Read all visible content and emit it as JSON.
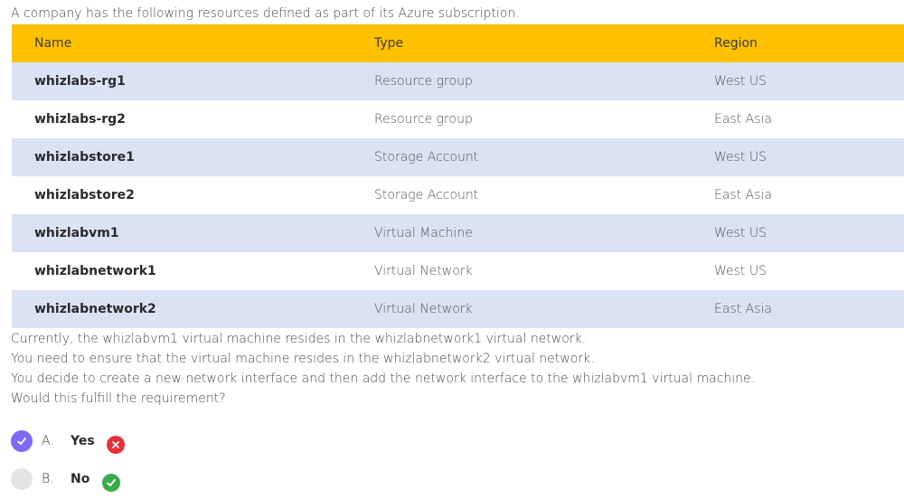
{
  "intro": "A company has the following resources defined as part of its Azure subscription.",
  "table": {
    "headers": [
      "Name",
      "Type",
      "Region"
    ],
    "rows": [
      {
        "name": "whizlabs-rg1",
        "type": "Resource group",
        "region": "West US"
      },
      {
        "name": "whizlabs-rg2",
        "type": "Resource group",
        "region": "East Asia"
      },
      {
        "name": "whizlabstore1",
        "type": "Storage Account",
        "region": "West US"
      },
      {
        "name": "whizlabstore2",
        "type": "Storage Account",
        "region": "East Asia"
      },
      {
        "name": "whizlabvm1",
        "type": "Virtual Machine",
        "region": "West US"
      },
      {
        "name": "whizlabnetwork1",
        "type": "Virtual Network",
        "region": "West US"
      },
      {
        "name": "whizlabnetwork2",
        "type": "Virtual Network",
        "region": "East Asia"
      }
    ]
  },
  "question": {
    "lines": [
      "Currently, the whizlabvm1 virtual machine resides in the whizlabnetwork1 virtual network.",
      "You need to ensure that the virtual machine resides in the whizlabnetwork2 virtual network.",
      "You decide to create a new network interface and then add the network interface to the whizlabvm1 virtual machine.",
      "Would this fulfill the requirement?"
    ]
  },
  "options": [
    {
      "letter": "A.",
      "text": "Yes",
      "selected": true,
      "result": "incorrect"
    },
    {
      "letter": "B.",
      "text": "No",
      "selected": false,
      "result": "correct"
    }
  ],
  "colors": {
    "header_bg": "#ffc000",
    "row_shade": "#dae3f3",
    "selected_radio": "#7b6cf6",
    "incorrect": "#e5303b",
    "correct": "#3aaa4c"
  },
  "icons": {
    "selected_radio": "check-icon",
    "incorrect": "x-icon",
    "correct": "check-icon"
  }
}
